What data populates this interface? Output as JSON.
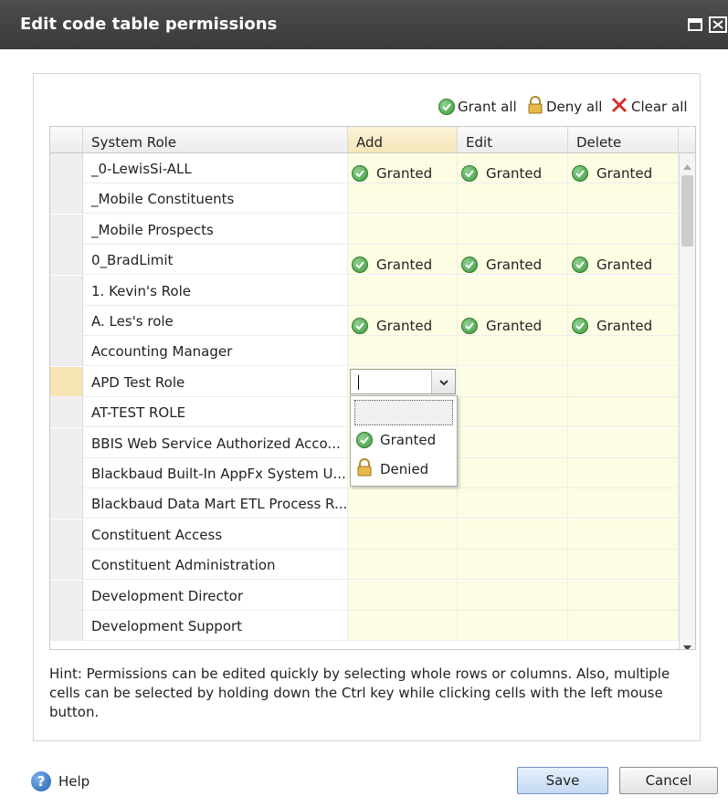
{
  "window": {
    "title": "Edit code table permissions"
  },
  "toolbar": {
    "grant_all": "Grant all",
    "deny_all": "Deny all",
    "clear_all": "Clear all"
  },
  "grid": {
    "columns": [
      "System Role",
      "Add",
      "Edit",
      "Delete"
    ],
    "rows": [
      {
        "role": "_0-LewisSi-ALL",
        "add": "Granted",
        "edit": "Granted",
        "delete": "Granted"
      },
      {
        "role": "_Mobile Constituents",
        "add": "",
        "edit": "",
        "delete": ""
      },
      {
        "role": "_Mobile Prospects",
        "add": "",
        "edit": "",
        "delete": ""
      },
      {
        "role": "0_BradLimit",
        "add": "Granted",
        "edit": "Granted",
        "delete": "Granted"
      },
      {
        "role": "1. Kevin's Role",
        "add": "",
        "edit": "",
        "delete": ""
      },
      {
        "role": "A. Les's role",
        "add": "Granted",
        "edit": "Granted",
        "delete": "Granted"
      },
      {
        "role": "Accounting Manager",
        "add": "",
        "edit": "",
        "delete": ""
      },
      {
        "role": "APD Test Role",
        "add": "",
        "edit": "",
        "delete": ""
      },
      {
        "role": "AT-TEST ROLE",
        "add": "",
        "edit": "",
        "delete": ""
      },
      {
        "role": "BBIS Web Service Authorized Acco...",
        "add": "",
        "edit": "",
        "delete": ""
      },
      {
        "role": "Blackbaud Built-In AppFx System U...",
        "add": "",
        "edit": "",
        "delete": ""
      },
      {
        "role": "Blackbaud Data Mart ETL Process R...",
        "add": "",
        "edit": "",
        "delete": ""
      },
      {
        "role": "Constituent Access",
        "add": "",
        "edit": "",
        "delete": ""
      },
      {
        "role": "Constituent Administration",
        "add": "",
        "edit": "",
        "delete": ""
      },
      {
        "role": "Development Director",
        "add": "",
        "edit": "",
        "delete": ""
      },
      {
        "role": "Development Support",
        "add": "",
        "edit": "",
        "delete": ""
      }
    ],
    "active_row": 7
  },
  "dropdown": {
    "value": "",
    "options": [
      "",
      "Granted",
      "Denied"
    ]
  },
  "hint": "Hint: Permissions can be edited quickly by selecting whole rows or columns. Also, multiple cells can be selected by holding down the Ctrl key while clicking cells with the left mouse button.",
  "footer": {
    "help": "Help",
    "save": "Save",
    "cancel": "Cancel"
  },
  "colors": {
    "titlebar": "#3f3f3f",
    "permission_cell": "#fdfde3",
    "active_row": "#f7e4b3",
    "granted_green": "#3f9a3f",
    "save_button": "#c4d9f2"
  }
}
